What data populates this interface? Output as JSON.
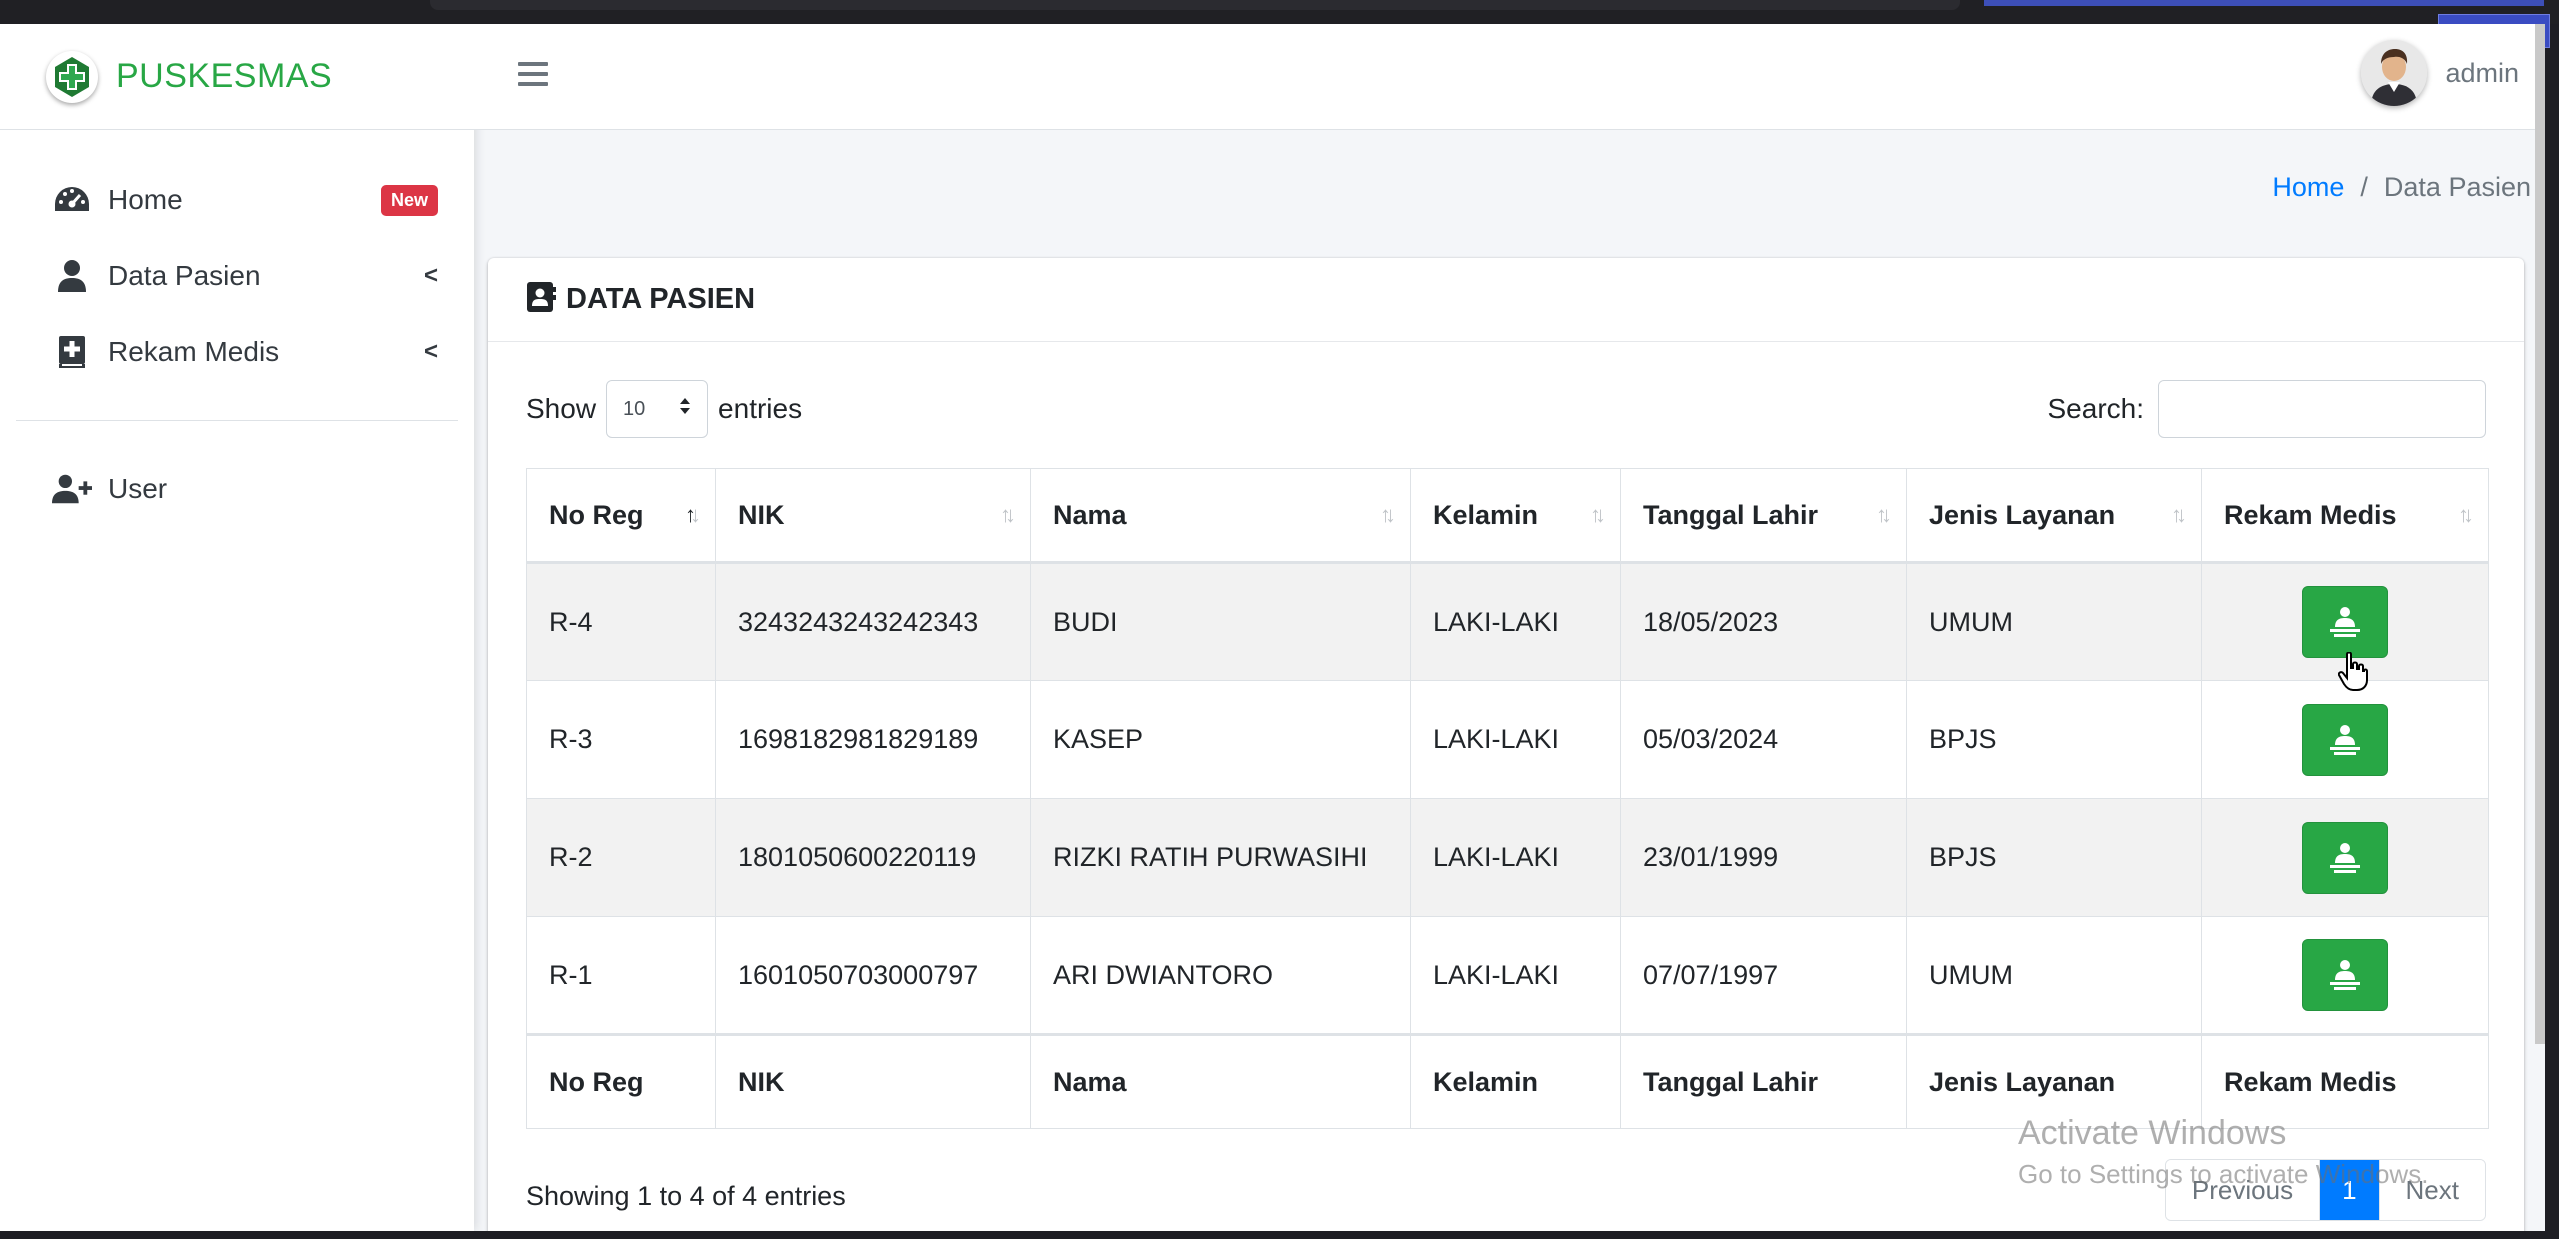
{
  "brand": {
    "name": "PUSKESMAS"
  },
  "sidebar": {
    "items": [
      {
        "label": "Home",
        "icon": "tachometer-icon",
        "badge": "New"
      },
      {
        "label": "Data Pasien",
        "icon": "user-icon",
        "arrow": "<"
      },
      {
        "label": "Rekam Medis",
        "icon": "medical-book-icon",
        "arrow": "<"
      },
      {
        "label": "User",
        "icon": "user-plus-icon"
      }
    ]
  },
  "topbar": {
    "user_name": "admin"
  },
  "breadcrumb": {
    "home": "Home",
    "separator": "/",
    "current": "Data Pasien"
  },
  "card": {
    "title": "DATA PASIEN"
  },
  "table_controls": {
    "show_label": "Show",
    "entries_label": "entries",
    "length_value": "10",
    "search_label": "Search:",
    "search_value": ""
  },
  "table": {
    "columns": [
      "No Reg",
      "NIK",
      "Nama",
      "Kelamin",
      "Tanggal Lahir",
      "Jenis Layanan",
      "Rekam Medis"
    ],
    "rows": [
      {
        "no_reg": "R-4",
        "nik": "3243243243242343",
        "nama": "BUDI",
        "kelamin": "LAKI-LAKI",
        "tanggal_lahir": "18/05/2023",
        "jenis_layanan": "UMUM"
      },
      {
        "no_reg": "R-3",
        "nik": "1698182981829189",
        "nama": "KASEP",
        "kelamin": "LAKI-LAKI",
        "tanggal_lahir": "05/03/2024",
        "jenis_layanan": "BPJS"
      },
      {
        "no_reg": "R-2",
        "nik": "1801050600220119",
        "nama": "RIZKI RATIH PURWASIHI",
        "kelamin": "LAKI-LAKI",
        "tanggal_lahir": "23/01/1999",
        "jenis_layanan": "BPJS"
      },
      {
        "no_reg": "R-1",
        "nik": "1601050703000797",
        "nama": "ARI DWIANTORO",
        "kelamin": "LAKI-LAKI",
        "tanggal_lahir": "07/07/1997",
        "jenis_layanan": "UMUM"
      }
    ]
  },
  "table_footer": {
    "info": "Showing 1 to 4 of 4 entries",
    "pagination": {
      "previous": "Previous",
      "current": "1",
      "next": "Next"
    }
  },
  "watermark": {
    "line1": "Activate Windows",
    "line2": "Go to Settings to activate Windows."
  },
  "colors": {
    "brand_green": "#28a745",
    "primary_blue": "#007bff",
    "badge_red": "#dc3545"
  }
}
